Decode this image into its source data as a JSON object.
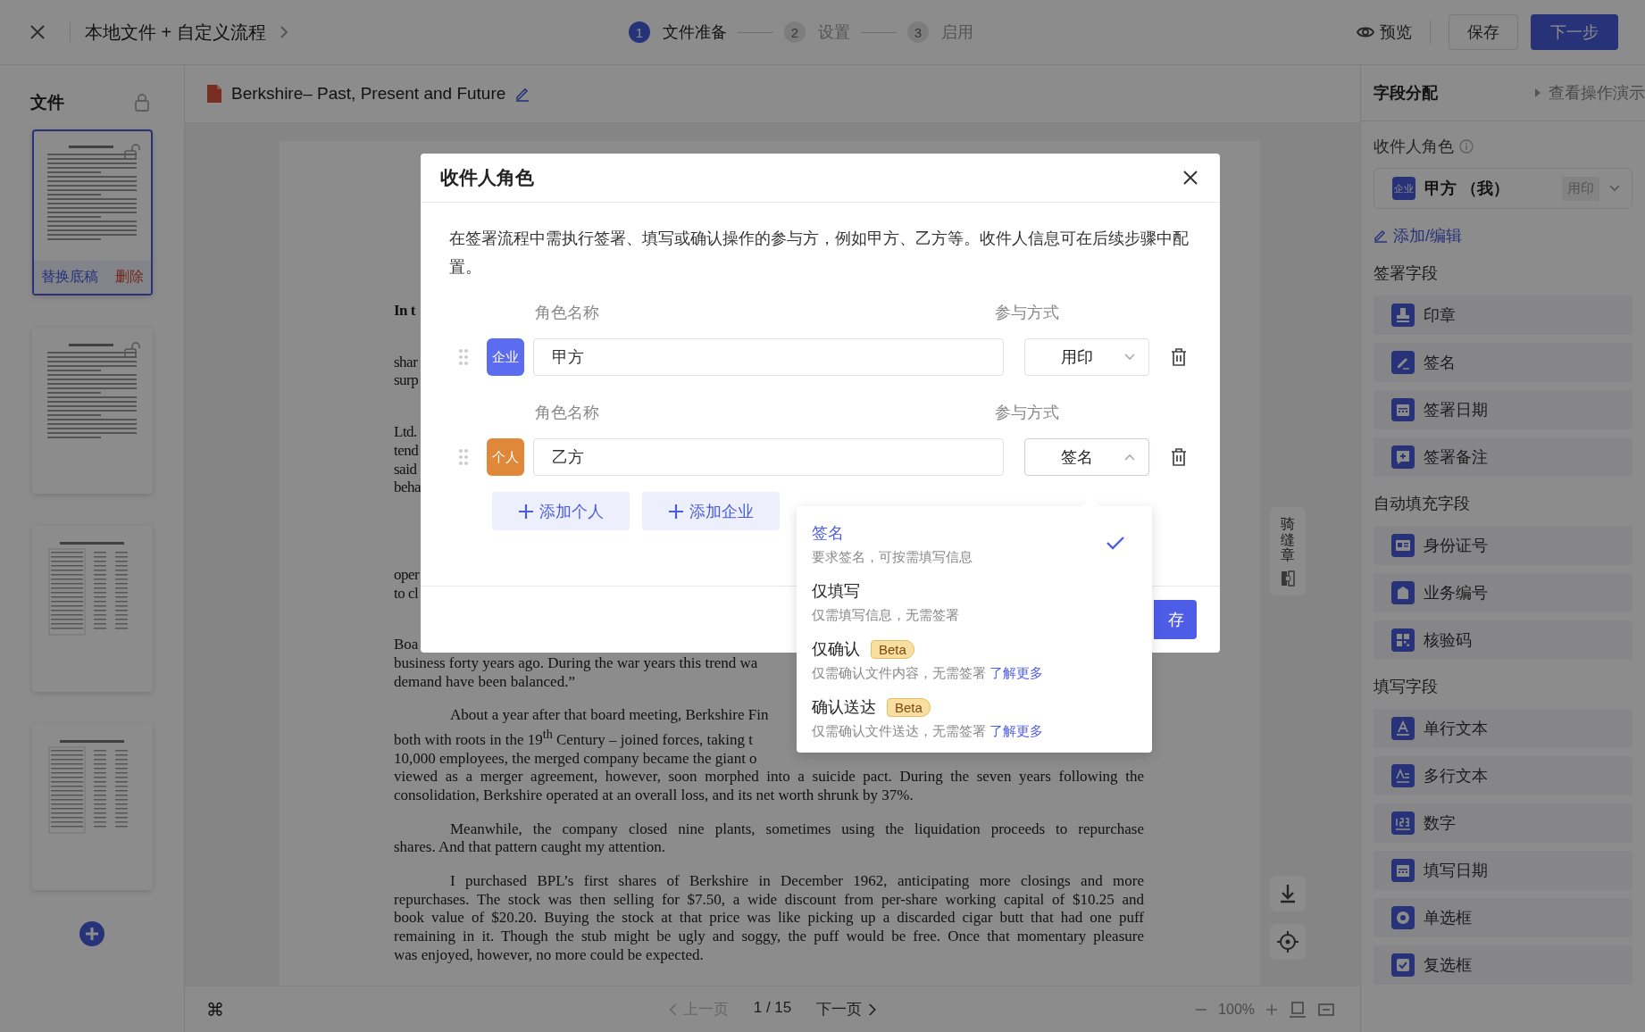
{
  "topbar": {
    "title": "本地文件 + 自定义流程",
    "steps": [
      {
        "number": "1",
        "label": "文件准备",
        "selected": true
      },
      {
        "number": "2",
        "label": "设置",
        "selected": false
      },
      {
        "number": "3",
        "label": "启用",
        "selected": false
      }
    ],
    "preview": "预览",
    "save": "保存",
    "next": "下一步"
  },
  "files": {
    "title": "文件",
    "pages": [
      {
        "kind": "text",
        "selected": true,
        "locked": true,
        "replace_label": "替换底稿",
        "delete_label": "删除"
      },
      {
        "kind": "text",
        "selected": false,
        "locked": true
      },
      {
        "kind": "table",
        "selected": false,
        "locked": false
      },
      {
        "kind": "table",
        "selected": false,
        "locked": false
      }
    ]
  },
  "document": {
    "file_name": "Berkshire– Past, Present and Future",
    "paragraphs": [
      {
        "bold": true,
        "indent": false,
        "lines": [
          {
            "text": "In t",
            "justified": false
          }
        ]
      },
      {
        "bold": false,
        "indent": false,
        "lines": [
          {
            "text": "shar",
            "justified": false
          },
          {
            "text": "surp",
            "justified": false
          }
        ]
      },
      {
        "bold": false,
        "indent": false,
        "lines": [
          {
            "text": "Ltd.",
            "justified": false
          },
          {
            "text": "tend",
            "justified": false
          },
          {
            "text": "said",
            "justified": false
          },
          {
            "text": "beha",
            "justified": false
          }
        ]
      },
      {
        "bold": false,
        "indent": false,
        "lines": [
          {
            "text": "oper",
            "justified": false
          },
          {
            "text": "to cl",
            "justified": false
          }
        ]
      },
      {
        "bold": false,
        "indent": false,
        "lines": [
          {
            "text": "Boa",
            "justified": false
          },
          {
            "text": "business forty years ago. During the war years this trend wa",
            "justified": false
          },
          {
            "text": "demand have been balanced.”",
            "justified": false
          }
        ]
      },
      {
        "bold": false,
        "indent": true,
        "lines": [
          {
            "text": "About a year after that board meeting, Berkshire Fin",
            "justified": false
          },
          {
            "text": "both with roots in the 19$^{th}$ Century – joined forces, taking t",
            "justified": false
          },
          {
            "text": "10,000 employees, the merged company became the giant o",
            "justified": false
          },
          {
            "text": "viewed as a merger agreement, however, soon morphed into a suicide pact. During the seven years following the",
            "justified": true
          },
          {
            "text": "consolidation, Berkshire operated at an overall loss, and its net worth shrunk by 37%.",
            "justified": false
          }
        ]
      },
      {
        "bold": false,
        "indent": true,
        "lines": [
          {
            "text": "Meanwhile, the company closed nine plants, sometimes using the liquidation proceeds to repurchase",
            "justified": true
          },
          {
            "text": "shares. And that pattern caught my attention.",
            "justified": false
          }
        ]
      },
      {
        "bold": false,
        "indent": true,
        "lines": [
          {
            "text": "I purchased BPL’s first shares of Berkshire in December 1962, anticipating more closings and more",
            "justified": true
          },
          {
            "text": "repurchases. The stock was then selling for $7.50, a wide discount from per-share working capital of $10.25 and",
            "justified": true
          },
          {
            "text": "book value of $20.20. Buying the stock at that price was like picking up a discarded cigar butt that had one puff",
            "justified": true
          },
          {
            "text": "remaining in it. Though the stub might be ugly and soggy, the puff would be free. Once that momentary pleasure",
            "justified": true
          },
          {
            "text": "was enjoyed, however, no more could be expected.",
            "justified": false
          }
        ]
      }
    ]
  },
  "tools": {
    "seam_seal": "骑缝章"
  },
  "pager": {
    "shortcut": "⌘",
    "prev": "上一页",
    "prev_disabled": true,
    "page": "1 / 15",
    "next": "下一页",
    "zoom": "100%"
  },
  "fields": {
    "title": "字段分配",
    "demo_link": "查看操作演示",
    "recipient_label": "收件人角色",
    "recipient": {
      "badge": "企业",
      "name": "甲方 （我）",
      "mode": "用印"
    },
    "edit_link": "添加/编辑",
    "sections": [
      {
        "title": "签署字段",
        "items": [
          "印章",
          "签名",
          "签署日期",
          "签署备注"
        ]
      },
      {
        "title": "自动填充字段",
        "items": [
          "身份证号",
          "业务编号",
          "核验码"
        ]
      },
      {
        "title": "填写字段",
        "items": [
          "单行文本",
          "多行文本",
          "数字",
          "填写日期",
          "单选框",
          "复选框"
        ]
      }
    ]
  },
  "modal": {
    "title": "收件人角色",
    "description": "在签署流程中需执行签署、填写或确认操作的参与方，例如甲方、乙方等。收件人信息可在后续步骤中配置。",
    "roles": [
      {
        "type": "企业",
        "color": "#5b6cf0",
        "name_label": "角色名称",
        "name": "甲方",
        "mode_label": "参与方式",
        "mode": "用印",
        "expanded": false
      },
      {
        "type": "个人",
        "color": "#e0883a",
        "name_label": "角色名称",
        "name": "乙方",
        "mode_label": "参与方式",
        "mode": "签名",
        "expanded": true
      }
    ],
    "add_buttons": [
      "添加个人",
      "添加企业"
    ],
    "save": "存",
    "options": [
      {
        "label": "签名",
        "description": "要求签名，可按需填写信息",
        "selected": true
      },
      {
        "label": "仅填写",
        "description": "仅需填写信息，无需签署",
        "selected": false
      },
      {
        "label": "仅确认",
        "badge": "Beta",
        "description": "仅需确认文件内容，无需签署",
        "link": "了解更多",
        "selected": false
      },
      {
        "label": "确认送达",
        "badge": "Beta",
        "description": "仅需确认文件送达，无需签署",
        "link": "了解更多",
        "selected": false
      }
    ]
  }
}
